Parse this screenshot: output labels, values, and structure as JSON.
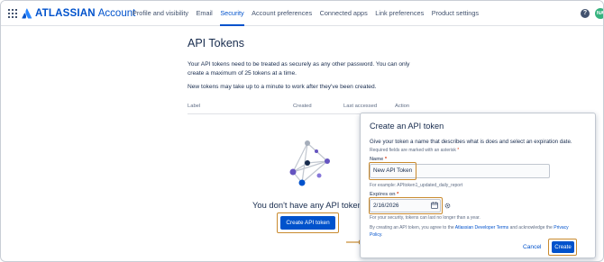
{
  "header": {
    "logo_text": "ATLASSIAN",
    "logo_sub": "Account",
    "nav": [
      {
        "label": "Profile and visibility",
        "active": false
      },
      {
        "label": "Email",
        "active": false
      },
      {
        "label": "Security",
        "active": true
      },
      {
        "label": "Account preferences",
        "active": false
      },
      {
        "label": "Connected apps",
        "active": false
      },
      {
        "label": "Link preferences",
        "active": false
      },
      {
        "label": "Product settings",
        "active": false
      }
    ],
    "help_glyph": "?",
    "avatar_initials": "NA"
  },
  "main": {
    "title": "API Tokens",
    "description": "Your API tokens need to be treated as securely as any other password. You can only create a maximum of 25 tokens at a time.",
    "note": "New tokens may take up to a minute to work after they've been created.",
    "table_headers": [
      "Label",
      "Created",
      "Last accessed",
      "Action"
    ],
    "empty_state": "You don't have any API token",
    "create_button": "Create API token"
  },
  "modal": {
    "title": "Create an API token",
    "description": "Give your token a name that describes what is does and select an expiration date.",
    "required_note": "Required fields are marked with an asterisk",
    "required_marker": "*",
    "name_label": "Name",
    "name_value": "New API Token",
    "name_help": "For example: APItoken1_updated_daily_report",
    "expires_label": "Expires on",
    "expires_value": "2/16/2026",
    "expires_help": "For your security, tokens can last no longer than a year.",
    "terms_pre": "By creating an API token, you agree to the ",
    "terms_link1": "Atlassian Developer Terms",
    "terms_mid": " and acknowledge the ",
    "terms_link2": "Privacy Policy",
    "terms_end": ".",
    "cancel_label": "Cancel",
    "create_label": "Create"
  },
  "colors": {
    "brand": "#0052cc",
    "highlight": "#c98a2e",
    "avatar": "#36b37e"
  }
}
